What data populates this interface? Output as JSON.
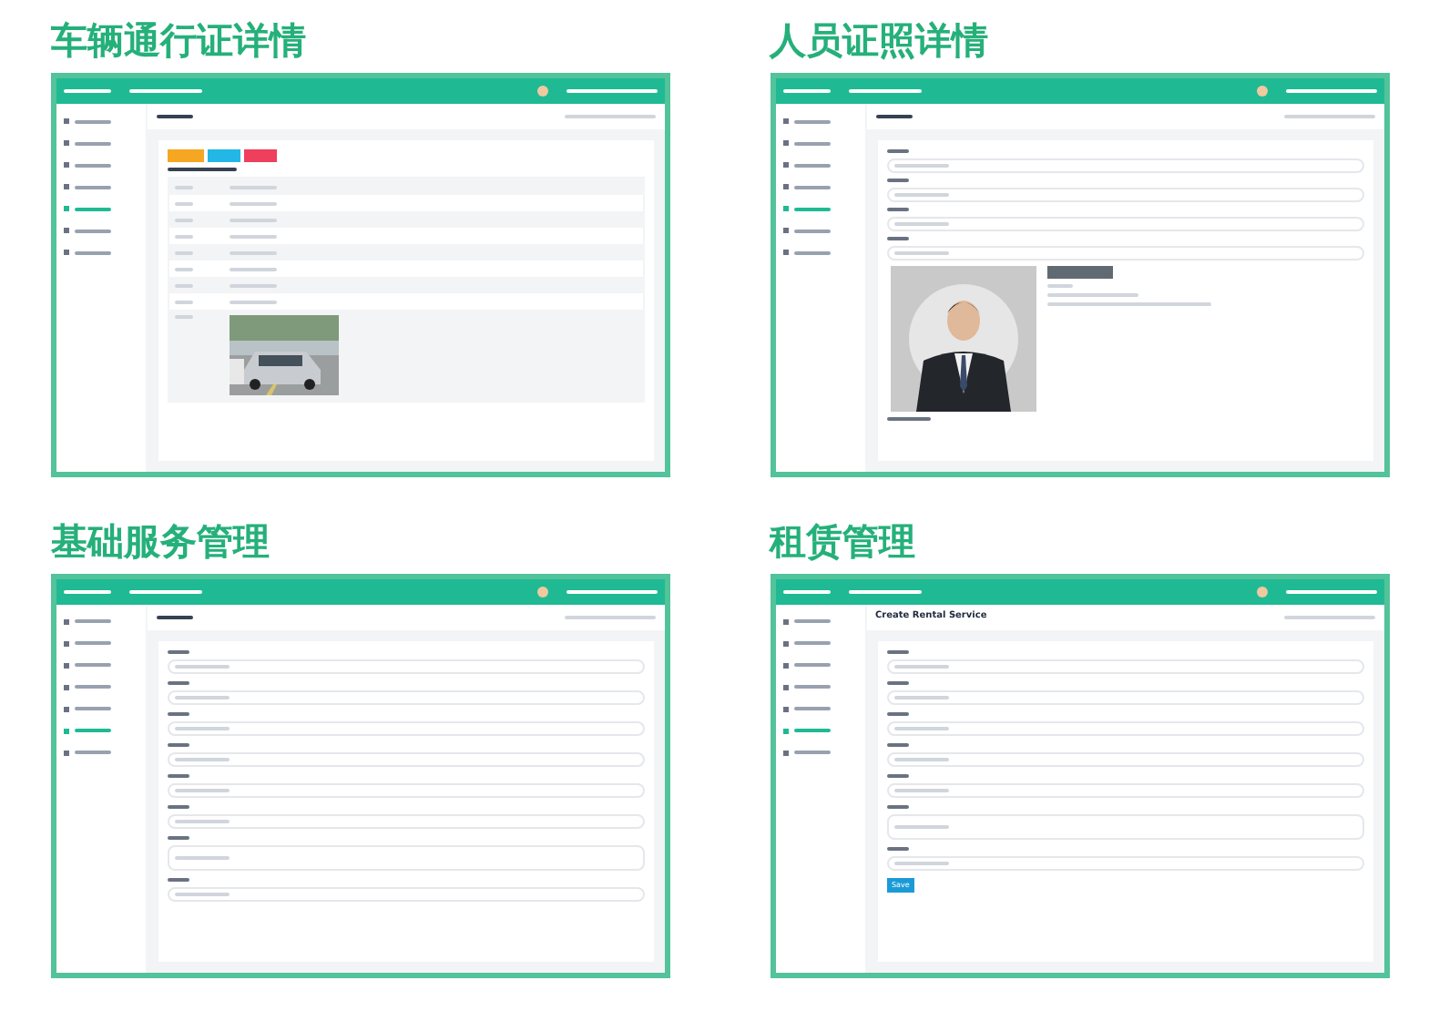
{
  "panels": [
    {
      "heading": "车辆通行证详情",
      "kind": "detail",
      "sidebar_items": [
        {
          "selected": false
        },
        {
          "selected": false
        },
        {
          "selected": false
        },
        {
          "selected": false
        },
        {
          "selected": true
        },
        {
          "selected": false
        },
        {
          "selected": false
        }
      ]
    },
    {
      "heading": "人员证照详情",
      "sidebar_items": [
        {
          "selected": false
        },
        {
          "selected": false
        },
        {
          "selected": false
        },
        {
          "selected": false
        },
        {
          "selected": true
        },
        {
          "selected": false
        },
        {
          "selected": false
        }
      ]
    },
    {
      "heading": "基础服务管理",
      "kind": "form",
      "sidebar_items": [
        {
          "selected": false
        },
        {
          "selected": false
        },
        {
          "selected": false
        },
        {
          "selected": false
        },
        {
          "selected": false
        },
        {
          "selected": true
        },
        {
          "selected": false
        }
      ]
    },
    {
      "heading": "租赁管理",
      "kind": "rental",
      "sidebar_items": [
        {
          "selected": false
        },
        {
          "selected": false
        },
        {
          "selected": false
        },
        {
          "selected": false
        },
        {
          "selected": false
        },
        {
          "selected": true
        },
        {
          "selected": false
        }
      ],
      "page_title": "Create Rental Service",
      "save_label": "Save"
    }
  ]
}
